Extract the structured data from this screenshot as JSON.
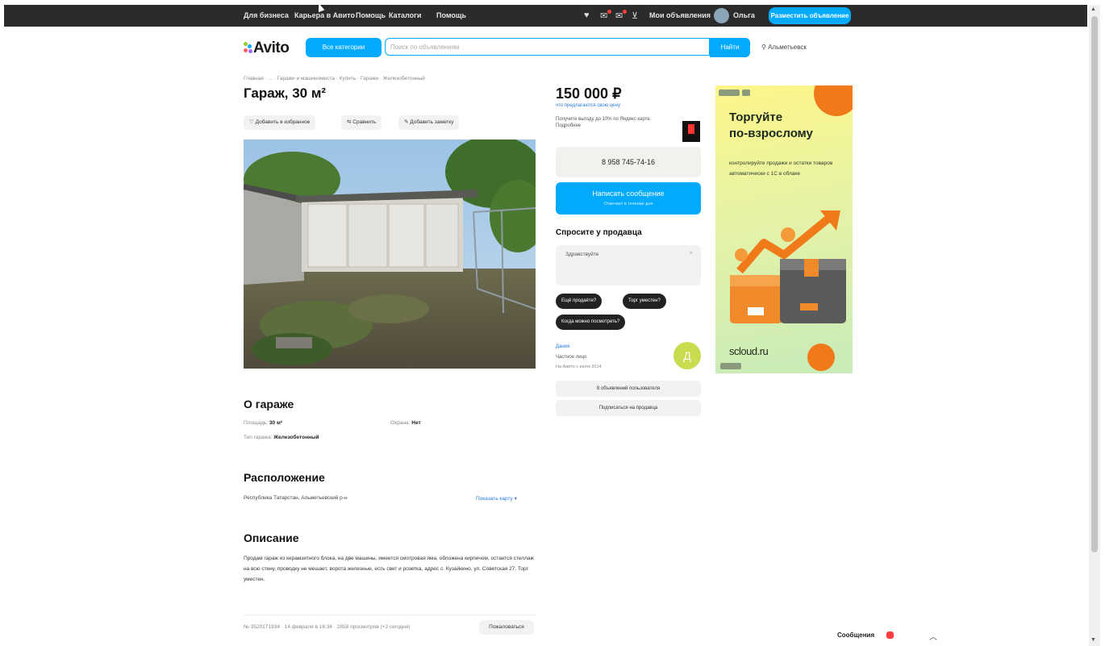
{
  "topbar": {
    "links": [
      "Для бизнеса",
      "Карьера в Авито",
      "Помощь",
      "Каталоги",
      "Помощь"
    ],
    "my_ads": "Мои объявления",
    "user": "Ольга",
    "place_ad": "Разместить объявление"
  },
  "header": {
    "logo": "Avito",
    "all_categories": "Все категории",
    "search_placeholder": "Поиск по объявлениям",
    "search_button": "Найти",
    "location": "Альметьевск"
  },
  "breadcrumbs": "Главная · ... · Гаражи и машиноместа · Купить · Гаражи · Железобетонный",
  "listing": {
    "title": "Гараж, 30 м²",
    "actions": {
      "favorite": "Добавить в избранное",
      "compare": "Сравнить",
      "note": "Добавить заметку"
    },
    "about_title": "О гараже",
    "area_label": "Площадь:",
    "area_value": "30 м²",
    "security_label": "Охрана:",
    "security_value": "Нет",
    "type_label": "Тип гаража:",
    "type_value": "Железобетонный",
    "location_title": "Расположение",
    "address": "Республика Татарстан, Альметьевский р-н",
    "show_map": "Показать карту ▾",
    "description_title": "Описание",
    "description": "Продам гараж из керамзитного блока, на две машины, имеется смотровая яма, обложена кирпичом, остается стеллаж на всю стену, проводку не мешает, ворота железные, есть свет и розетка, адрес с. Кузайкино, ул. Советская 27. Торг уместен.",
    "footer": "№ 3520171934 · 14 февраля в 16:36 · 2858 просмотров (+2 сегодня)",
    "complain": "Пожаловаться"
  },
  "sidebar": {
    "price": "150 000 ₽",
    "price_note": "что предлагаются свою цену",
    "delivery": "Получите выгоду до 10% по Яндекс карте. Подробнее",
    "phone": "8 958 745-74-16",
    "write_message": "Написать сообщение",
    "write_message_sub": "Отвечает в течение дня",
    "ask_title": "Спросите у продавца",
    "ask_placeholder": "Здравствуйте",
    "chips": [
      "Ещё продаёте?",
      "Торг уместен?",
      "Когда можно посмотреть?"
    ],
    "seller_name": "Дания",
    "seller_type": "Частное лицо",
    "seller_since": "На Авито с июля 2014",
    "seller_initial": "Д",
    "other_ads": "8 объявлений пользователя",
    "subscribe": "Подписаться на продавца"
  },
  "ad_banner": {
    "title": "Торгуйте по‑взрослому",
    "body": "контролируйте продажи и остатки товаров автоматически с 1С в облаке",
    "brand": "scloud.ru"
  },
  "widget": {
    "messages": "Сообщения"
  },
  "colors": {
    "accent": "#00aaff",
    "topbar": "#2b2b2b"
  }
}
